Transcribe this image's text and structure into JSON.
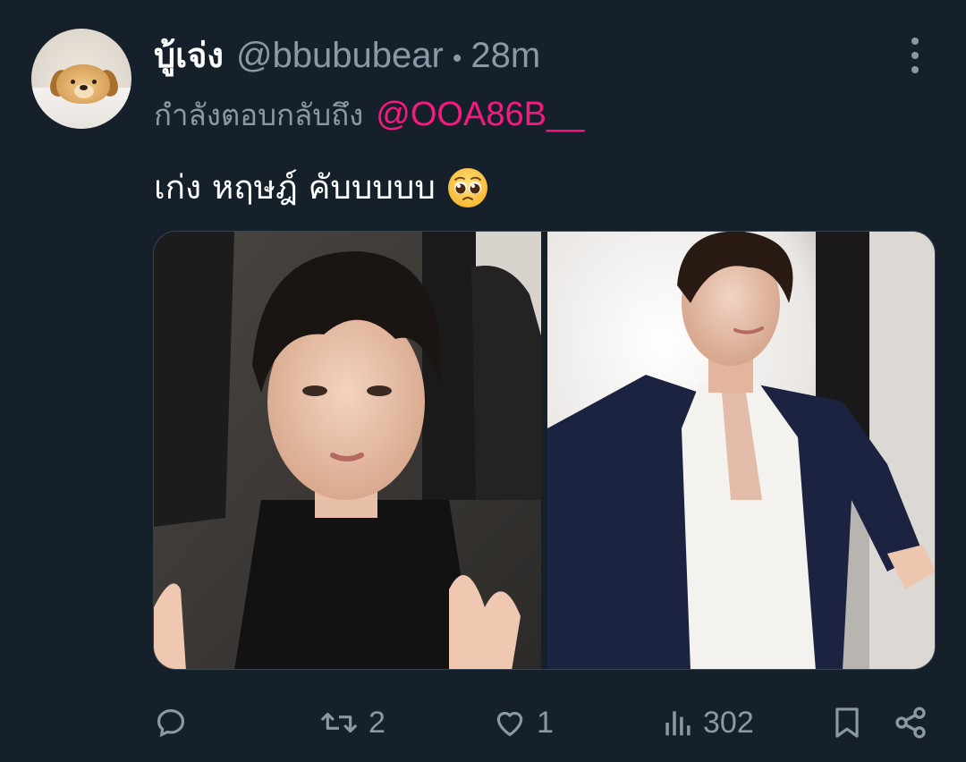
{
  "tweet": {
    "display_name": "บู้เจ่ง",
    "handle": "@bbububear",
    "separator": "•",
    "time": "28m",
    "reply_prefix": "กำลังตอบกลับถึง",
    "reply_to": "@OOA86B__",
    "text": "เก่ง หฤษฎ์ คับบบบบ",
    "text_emoji": "pleading-face-emoji",
    "avatar_icon": "golden-puppy-avatar"
  },
  "media": {
    "count": 2
  },
  "actions": {
    "reply_count": "",
    "retweet_count": "2",
    "like_count": "1",
    "views_count": "302"
  },
  "colors": {
    "background": "#15202b",
    "text_primary": "#ffffff",
    "text_secondary": "#8b98a5",
    "mention": "#f91880",
    "border": "#38444d"
  }
}
